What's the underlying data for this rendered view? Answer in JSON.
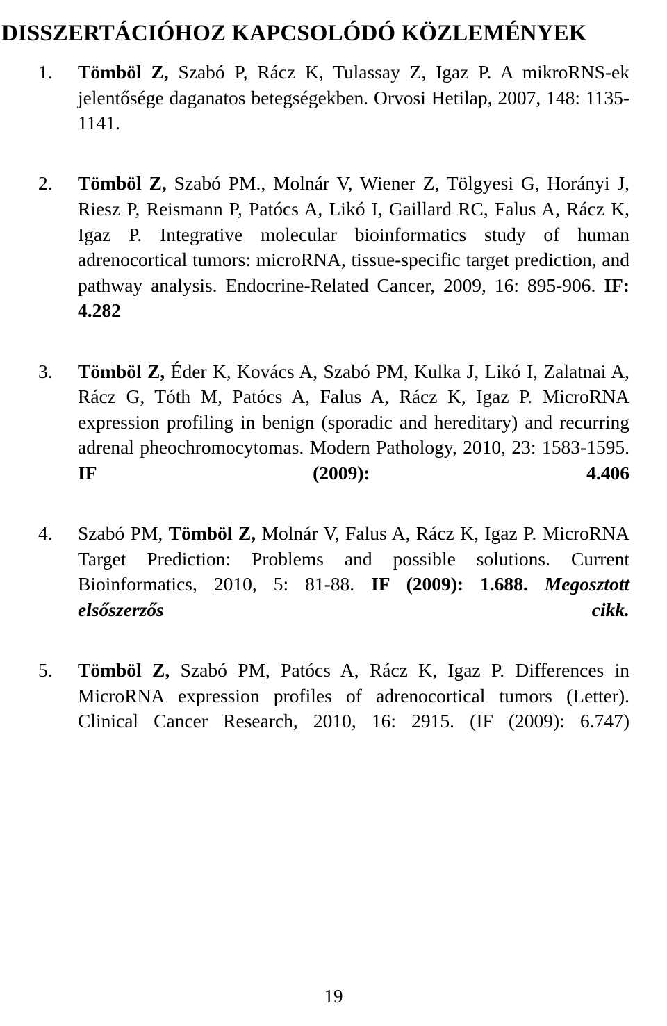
{
  "document": {
    "title": "DISSZERTÁCIÓHOZ KAPCSOLÓDÓ KÖZLEMÉNYEK",
    "page_number": "19",
    "language": "hu"
  },
  "references": [
    {
      "number": "1.",
      "authors_bold": "Tömböl Z,",
      "authors_rest": " Szabó P, Rácz K, Tulassay Z, Igaz P.",
      "title": " A mikroRNS-ek jelentősége daganatos betegségekben.",
      "source": " Orvosi Hetilap, 2007, 148: 1135-1141.",
      "impact_factor": "",
      "note": ""
    },
    {
      "number": "2.",
      "authors_bold": "Tömböl Z,",
      "authors_rest": " Szabó PM., Molnár V, Wiener Z, Tölgyesi G, Horányi J, Riesz P, Reismann P, Patócs A, Likó I, Gaillard RC, Falus A, Rácz K, Igaz P.",
      "title": " Integrative molecular bioinformatics study of human adrenocortical tumors: microRNA, tissue-specific target prediction, and pathway analysis.",
      "source": " Endocrine-Related Cancer, 2009, 16: 895-906.",
      "impact_factor": "IF: 4.282",
      "note": ""
    },
    {
      "number": "3.",
      "authors_bold": "Tömböl Z,",
      "authors_rest": " Éder K, Kovács A, Szabó PM, Kulka J, Likó I, Zalatnai A, Rácz G, Tóth M, Patócs A, Falus A, Rácz K, Igaz P.",
      "title": " MicroRNA expression profiling in benign (sporadic and hereditary) and recurring adrenal pheochromocytomas.",
      "source": " Modern Pathology, 2010, 23: 1583-1595.",
      "impact_factor": "IF (2009): 4.406",
      "note": ""
    },
    {
      "number": "4.",
      "authors_pre": "Szabó PM, ",
      "authors_bold": "Tömböl Z,",
      "authors_rest": " Molnár V, Falus A, Rácz K, Igaz P.",
      "title": " MicroRNA Target Prediction: Problems and possible solutions.",
      "source": " Current Bioinformatics, 2010, 5: 81-88.",
      "impact_factor": "IF (2009): 1.688.",
      "note": "Megosztott elsőszerzős cikk."
    },
    {
      "number": "5.",
      "authors_bold": "Tömböl Z,",
      "authors_rest": " Szabó PM, Patócs A, Rácz K, Igaz P.",
      "title": " Differences in MicroRNA expression profiles of adrenocortical tumors (Letter).",
      "source": " Clinical Cancer Research, 2010, 16: 2915.",
      "impact_factor_plain": "(IF (2009): 6.747)",
      "note": ""
    }
  ]
}
